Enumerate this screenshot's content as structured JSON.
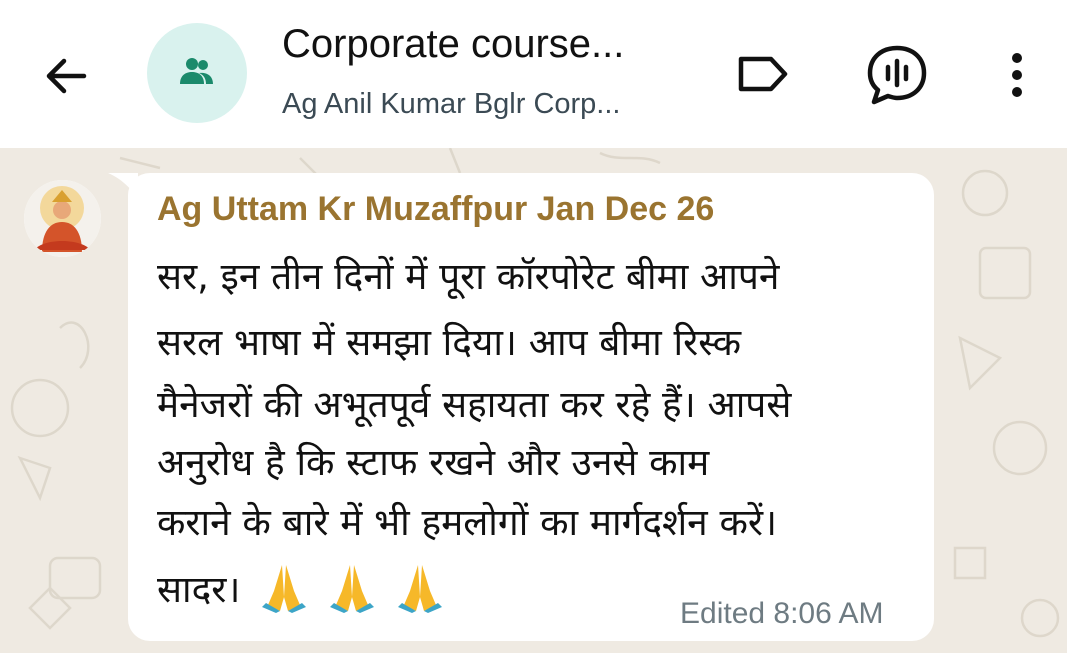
{
  "header": {
    "title": "Corporate course...",
    "subtitle": "Ag Anil Kumar Bglr Corp...",
    "avatar_icon": "group-icon",
    "accent": "#1b8a6b"
  },
  "message": {
    "sender": "Ag Uttam Kr Muzaffpur Jan Dec 26",
    "sender_color": "#9a7430",
    "lines": [
      "सर, इन तीन दिनों में पूरा कॉरपोरेट बीमा आपने",
      "सरल भाषा में समझा दिया। आप बीमा रिस्क",
      "मैनेजरों की अभूतपूर्व सहायता कर रहे हैं। आपसे",
      "अनुरोध है कि स्टाफ रखने और उनसे काम",
      "कराने के बारे में भी हमलोगों का मार्गदर्शन करें।",
      "सादर।"
    ],
    "emojis": [
      "folded-hands",
      "folded-hands",
      "folded-hands"
    ],
    "meta": "Edited 8:06 AM"
  }
}
